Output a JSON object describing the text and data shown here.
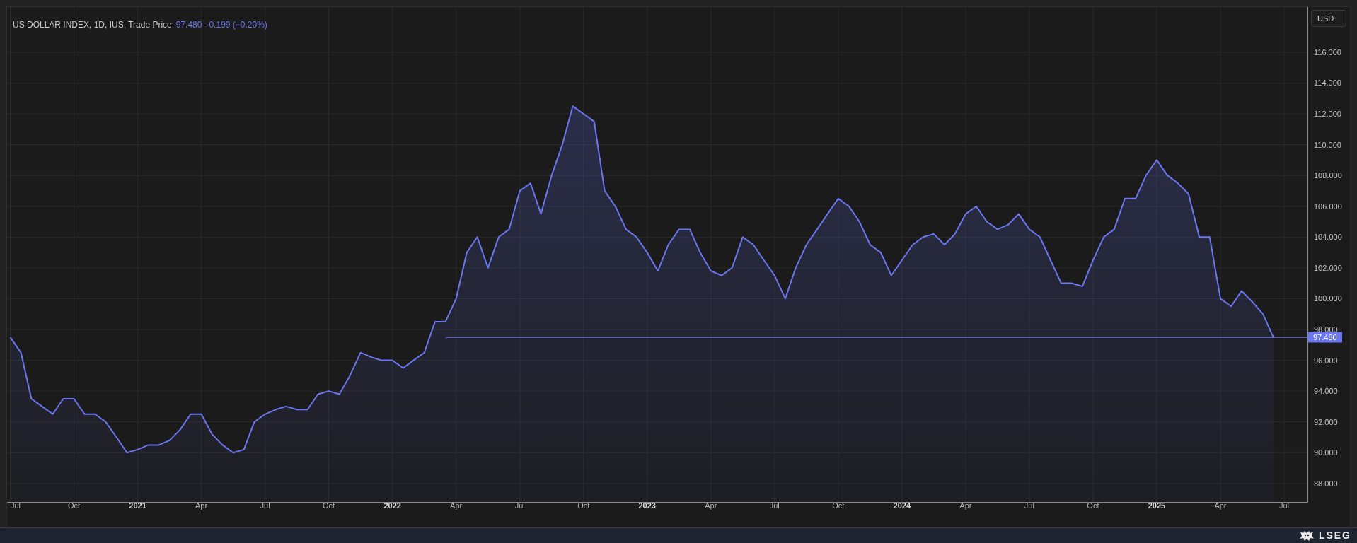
{
  "legend": {
    "title": "US DOLLAR INDEX, 1D, IUS, Trade Price",
    "last": "97.480",
    "change": "-0.199 (−0.20%)"
  },
  "currency_button": "USD",
  "last_price_label": "97.480",
  "chart_data": {
    "type": "area",
    "grid": true,
    "x": [
      2020.5,
      2020.542,
      2020.583,
      2020.625,
      2020.667,
      2020.708,
      2020.75,
      2020.792,
      2020.833,
      2020.875,
      2020.917,
      2020.958,
      2021,
      2021.042,
      2021.083,
      2021.125,
      2021.167,
      2021.208,
      2021.25,
      2021.292,
      2021.333,
      2021.375,
      2021.417,
      2021.458,
      2021.5,
      2021.542,
      2021.583,
      2021.625,
      2021.667,
      2021.708,
      2021.75,
      2021.792,
      2021.833,
      2021.875,
      2021.917,
      2021.958,
      2022,
      2022.042,
      2022.083,
      2022.125,
      2022.167,
      2022.208,
      2022.25,
      2022.292,
      2022.333,
      2022.375,
      2022.417,
      2022.458,
      2022.5,
      2022.542,
      2022.583,
      2022.625,
      2022.667,
      2022.708,
      2022.75,
      2022.792,
      2022.833,
      2022.875,
      2022.917,
      2022.958,
      2023,
      2023.042,
      2023.083,
      2023.125,
      2023.167,
      2023.208,
      2023.25,
      2023.292,
      2023.333,
      2023.375,
      2023.417,
      2023.458,
      2023.5,
      2023.542,
      2023.583,
      2023.625,
      2023.667,
      2023.708,
      2023.75,
      2023.792,
      2023.833,
      2023.875,
      2023.917,
      2023.958,
      2024,
      2024.042,
      2024.083,
      2024.125,
      2024.167,
      2024.208,
      2024.25,
      2024.292,
      2024.333,
      2024.375,
      2024.417,
      2024.458,
      2024.5,
      2024.542,
      2024.583,
      2024.625,
      2024.667,
      2024.708,
      2024.75,
      2024.792,
      2024.833,
      2024.875,
      2024.917,
      2024.958,
      2025,
      2025.042,
      2025.083,
      2025.125,
      2025.167,
      2025.208,
      2025.25,
      2025.292,
      2025.333,
      2025.375,
      2025.417,
      2025.458
    ],
    "series": [
      {
        "color": "#6b77f0",
        "values": [
          97.5,
          96.5,
          93.5,
          93,
          92.5,
          93.5,
          93.5,
          92.5,
          92.5,
          92,
          91,
          90,
          90.2,
          90.5,
          90.5,
          90.8,
          91.5,
          92.5,
          92.5,
          91.2,
          90.5,
          90,
          90.2,
          92,
          92.5,
          92.8,
          93,
          92.8,
          92.8,
          93.8,
          94,
          93.8,
          95,
          96.5,
          96.2,
          96,
          96,
          95.5,
          96,
          96.5,
          98.5,
          98.5,
          100,
          103,
          104,
          102,
          104,
          104.5,
          107,
          107.5,
          105.5,
          108,
          110,
          112.5,
          112,
          111.5,
          107,
          106,
          104.5,
          104,
          103,
          101.8,
          103.5,
          104.5,
          104.5,
          103,
          101.8,
          101.5,
          102,
          104,
          103.5,
          102.5,
          101.5,
          100,
          102,
          103.5,
          104.5,
          105.5,
          106.5,
          106,
          105,
          103.5,
          103,
          101.5,
          102.5,
          103.5,
          104,
          104.2,
          103.5,
          104.2,
          105.5,
          106,
          105,
          104.5,
          104.8,
          105.5,
          104.5,
          104,
          102.5,
          101,
          101,
          100.8,
          102.5,
          104,
          104.5,
          106.5,
          106.5,
          108,
          109,
          108,
          107.5,
          106.8,
          104,
          104,
          100,
          99.5,
          100.5,
          99.8,
          99,
          97.48
        ]
      }
    ],
    "xlim": [
      2020.4875,
      2025.5917
    ],
    "ylim": [
      86.8,
      118.93
    ],
    "xticks": [
      {
        "value": 2020.5,
        "label": "Jul"
      },
      {
        "value": 2020.75,
        "label": "Oct"
      },
      {
        "value": 2021,
        "label": "2021"
      },
      {
        "value": 2021.25,
        "label": "Apr"
      },
      {
        "value": 2021.5,
        "label": "Jul"
      },
      {
        "value": 2021.75,
        "label": "Oct"
      },
      {
        "value": 2022,
        "label": "2022"
      },
      {
        "value": 2022.25,
        "label": "Apr"
      },
      {
        "value": 2022.5,
        "label": "Jul"
      },
      {
        "value": 2022.75,
        "label": "Oct"
      },
      {
        "value": 2023,
        "label": "2023"
      },
      {
        "value": 2023.25,
        "label": "Apr"
      },
      {
        "value": 2023.5,
        "label": "Jul"
      },
      {
        "value": 2023.75,
        "label": "Oct"
      },
      {
        "value": 2024,
        "label": "2024"
      },
      {
        "value": 2024.25,
        "label": "Apr"
      },
      {
        "value": 2024.5,
        "label": "Jul"
      },
      {
        "value": 2024.75,
        "label": "Oct"
      },
      {
        "value": 2025,
        "label": "2025"
      },
      {
        "value": 2025.25,
        "label": "Apr"
      },
      {
        "value": 2025.5,
        "label": "Jul"
      }
    ],
    "yticks": [
      {
        "value": 88,
        "label": "88.000"
      },
      {
        "value": 90,
        "label": "90.000"
      },
      {
        "value": 92,
        "label": "92.000"
      },
      {
        "value": 94,
        "label": "94.000"
      },
      {
        "value": 96,
        "label": "96.000"
      },
      {
        "value": 98,
        "label": "98.000"
      },
      {
        "value": 100,
        "label": "100.000"
      },
      {
        "value": 102,
        "label": "102.000"
      },
      {
        "value": 104,
        "label": "104.000"
      },
      {
        "value": 106,
        "label": "106.000"
      },
      {
        "value": 108,
        "label": "108.000"
      },
      {
        "value": 110,
        "label": "110.000"
      },
      {
        "value": 112,
        "label": "112.000"
      },
      {
        "value": 114,
        "label": "114.000"
      },
      {
        "value": 116,
        "label": "116.000"
      }
    ]
  },
  "brand": "LSEG"
}
